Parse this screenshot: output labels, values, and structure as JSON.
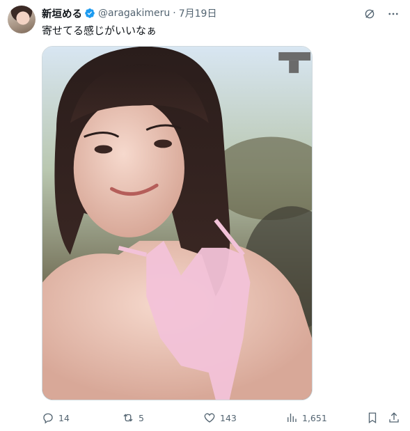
{
  "tweet": {
    "author_name": "新垣める",
    "handle": "@aragakimeru",
    "separator": "·",
    "date": "7月19日",
    "text": "寄せてる感じがいいなぁ"
  },
  "actions": {
    "replies": "14",
    "reposts": "5",
    "likes": "143",
    "views": "1,651"
  },
  "icons": [
    "grok-icon",
    "more-icon",
    "reply-icon",
    "repost-icon",
    "like-icon",
    "views-icon",
    "bookmark-icon",
    "share-icon",
    "verified-badge-icon"
  ],
  "colors": {
    "verified": "#1d9bf0",
    "secondary_text": "#536471"
  }
}
